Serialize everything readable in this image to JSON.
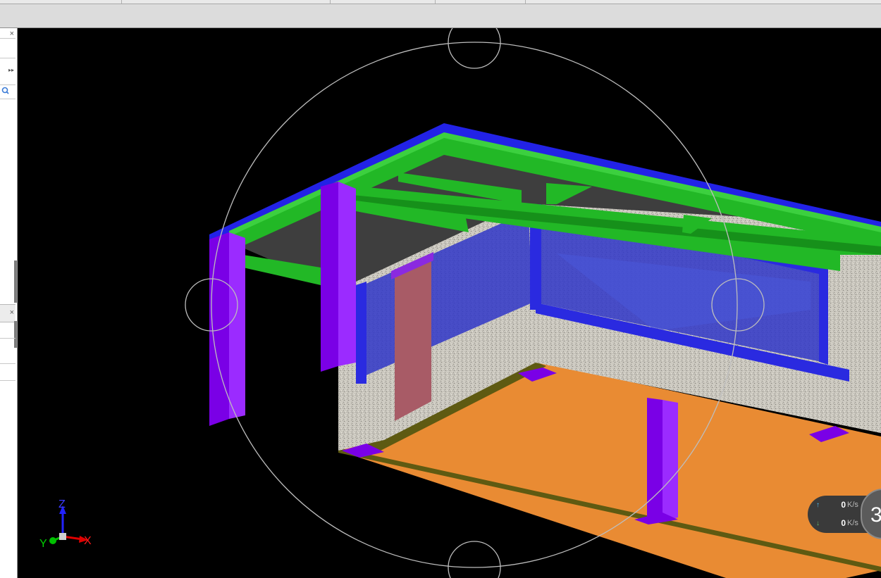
{
  "panels": {
    "close_glyph": "×",
    "expand_glyph": "▸▸",
    "search_icon": "magnifier-icon"
  },
  "axes": {
    "z": "Z",
    "y": "Y",
    "x": "X"
  },
  "speed_monitor": {
    "upload": {
      "value": "0",
      "unit": "K/s",
      "arrow": "↑"
    },
    "download": {
      "value": "0",
      "unit": "K/s",
      "arrow": "↓"
    },
    "badge": "3"
  },
  "colors": {
    "beam": "#22b826",
    "roof_edge": "#2222e6",
    "column": "#7a00e6",
    "floor": "#e98b33",
    "wall": "#c9c6bd",
    "glass": "#3036c8",
    "viewport_bg": "#000000"
  }
}
